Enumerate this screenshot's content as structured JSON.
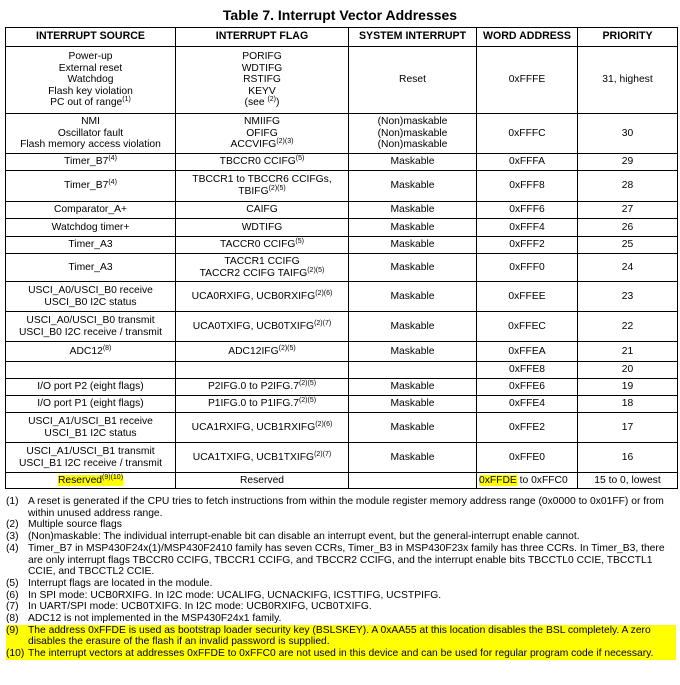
{
  "title": "Table 7. Interrupt Vector Addresses",
  "headers": [
    "INTERRUPT SOURCE",
    "INTERRUPT FLAG",
    "SYSTEM INTERRUPT",
    "WORD ADDRESS",
    "PRIORITY"
  ],
  "rows": [
    {
      "source": [
        "Power-up",
        "External reset",
        "Watchdog",
        "Flash key violation",
        "PC out of range"
      ],
      "source_sup": [
        "",
        "",
        "",
        "",
        "(1)"
      ],
      "flag": [
        "PORIFG",
        "WDTIFG",
        "RSTIFG",
        "KEYV",
        "(see "
      ],
      "flag_sup": [
        "",
        "",
        "",
        "",
        "(2)"
      ],
      "flag_after": [
        "",
        "",
        "",
        "",
        ")"
      ],
      "system": [
        "Reset"
      ],
      "address": "0xFFFE",
      "priority": "31, highest"
    },
    {
      "source": [
        "NMI",
        "Oscillator fault",
        "Flash memory access violation"
      ],
      "source_sup": [
        "",
        "",
        ""
      ],
      "flag": [
        "NMIIFG",
        "OFIFG",
        "ACCVIFG"
      ],
      "flag_sup": [
        "",
        "",
        "(2)(3)"
      ],
      "flag_after": [
        "",
        "",
        ""
      ],
      "system": [
        "(Non)maskable",
        "(Non)maskable",
        "(Non)maskable"
      ],
      "address": "0xFFFC",
      "priority": "30"
    },
    {
      "source": [
        "Timer_B7"
      ],
      "source_sup": [
        "(4)"
      ],
      "flag": [
        "TBCCR0 CCIFG"
      ],
      "flag_sup": [
        "(5)"
      ],
      "flag_after": [
        ""
      ],
      "system": [
        "Maskable"
      ],
      "address": "0xFFFA",
      "priority": "29"
    },
    {
      "source": [
        "Timer_B7"
      ],
      "source_sup": [
        "(4)"
      ],
      "flag": [
        "TBCCR1 to TBCCR6 CCIFGs,",
        "TBIFG"
      ],
      "flag_sup": [
        "",
        "(2)(5)"
      ],
      "flag_after": [
        "",
        ""
      ],
      "system": [
        "Maskable"
      ],
      "address": "0xFFF8",
      "priority": "28"
    },
    {
      "source": [
        "Comparator_A+"
      ],
      "source_sup": [
        ""
      ],
      "flag": [
        "CAIFG"
      ],
      "flag_sup": [
        ""
      ],
      "flag_after": [
        ""
      ],
      "system": [
        "Maskable"
      ],
      "address": "0xFFF6",
      "priority": "27"
    },
    {
      "source": [
        "Watchdog timer+"
      ],
      "source_sup": [
        ""
      ],
      "flag": [
        "WDTIFG"
      ],
      "flag_sup": [
        ""
      ],
      "flag_after": [
        ""
      ],
      "system": [
        "Maskable"
      ],
      "address": "0xFFF4",
      "priority": "26"
    },
    {
      "source": [
        "Timer_A3"
      ],
      "source_sup": [
        ""
      ],
      "flag": [
        "TACCR0 CCIFG"
      ],
      "flag_sup": [
        "(5)"
      ],
      "flag_after": [
        ""
      ],
      "system": [
        "Maskable"
      ],
      "address": "0xFFF2",
      "priority": "25"
    },
    {
      "source": [
        "Timer_A3"
      ],
      "source_sup": [
        ""
      ],
      "flag": [
        "TACCR1 CCIFG",
        "TACCR2 CCIFG TAIFG"
      ],
      "flag_sup": [
        "",
        "(2)(5)"
      ],
      "flag_after": [
        "",
        ""
      ],
      "system": [
        "Maskable"
      ],
      "address": "0xFFF0",
      "priority": "24"
    },
    {
      "source": [
        "USCI_A0/USCI_B0 receive",
        "USCI_B0 I2C status"
      ],
      "source_sup": [
        "",
        ""
      ],
      "flag": [
        "UCA0RXIFG, UCB0RXIFG"
      ],
      "flag_sup": [
        "(2)(6)"
      ],
      "flag_after": [
        ""
      ],
      "system": [
        "Maskable"
      ],
      "address": "0xFFEE",
      "priority": "23"
    },
    {
      "source": [
        "USCI_A0/USCI_B0 transmit",
        "USCI_B0 I2C receive / transmit"
      ],
      "source_sup": [
        "",
        ""
      ],
      "flag": [
        "UCA0TXIFG, UCB0TXIFG"
      ],
      "flag_sup": [
        "(2)(7)"
      ],
      "flag_after": [
        ""
      ],
      "system": [
        "Maskable"
      ],
      "address": "0xFFEC",
      "priority": "22"
    },
    {
      "source": [
        "ADC12"
      ],
      "source_sup": [
        "(8)"
      ],
      "flag": [
        "ADC12IFG"
      ],
      "flag_sup": [
        "(2)(5)"
      ],
      "flag_after": [
        ""
      ],
      "system": [
        "Maskable"
      ],
      "address": "0xFFEA",
      "priority": "21"
    },
    {
      "source": [
        ""
      ],
      "source_sup": [
        ""
      ],
      "flag": [
        ""
      ],
      "flag_sup": [
        ""
      ],
      "flag_after": [
        ""
      ],
      "system": [
        ""
      ],
      "address": "0xFFE8",
      "priority": "20"
    },
    {
      "source": [
        "I/O port P2 (eight flags)"
      ],
      "source_sup": [
        ""
      ],
      "flag": [
        "P2IFG.0 to P2IFG.7"
      ],
      "flag_sup": [
        "(2)(5)"
      ],
      "flag_after": [
        ""
      ],
      "system": [
        "Maskable"
      ],
      "address": "0xFFE6",
      "priority": "19"
    },
    {
      "source": [
        "I/O port P1 (eight flags)"
      ],
      "source_sup": [
        ""
      ],
      "flag": [
        "P1IFG.0 to P1IFG.7"
      ],
      "flag_sup": [
        "(2)(5)"
      ],
      "flag_after": [
        ""
      ],
      "system": [
        "Maskable"
      ],
      "address": "0xFFE4",
      "priority": "18"
    },
    {
      "source": [
        "USCI_A1/USCI_B1 receive",
        "USCI_B1 I2C status"
      ],
      "source_sup": [
        "",
        ""
      ],
      "flag": [
        "UCA1RXIFG, UCB1RXIFG"
      ],
      "flag_sup": [
        "(2)(6)"
      ],
      "flag_after": [
        ""
      ],
      "system": [
        "Maskable"
      ],
      "address": "0xFFE2",
      "priority": "17"
    },
    {
      "source": [
        "USCI_A1/USCI_B1 transmit",
        "USCI_B1 I2C receive / transmit"
      ],
      "source_sup": [
        "",
        ""
      ],
      "flag": [
        "UCA1TXIFG, UCB1TXIFG"
      ],
      "flag_sup": [
        "(2)(7)"
      ],
      "flag_after": [
        ""
      ],
      "system": [
        "Maskable"
      ],
      "address": "0xFFE0",
      "priority": "16"
    }
  ],
  "reserved_row": {
    "source": "Reserved",
    "source_sup": "(9)(10)",
    "flag": "Reserved",
    "system": "",
    "address_start": "0xFFDE",
    "address_rest": " to 0xFFC0",
    "priority": "15 to 0, lowest"
  },
  "highlight_color": "#ffff00",
  "footnotes": [
    {
      "num": "(1)",
      "text": "A reset is generated if the CPU tries to fetch instructions from within the module register memory address range (0x0000 to 0x01FF) or from within unused address range.",
      "highlighted": false
    },
    {
      "num": "(2)",
      "text": "Multiple source flags",
      "highlighted": false
    },
    {
      "num": "(3)",
      "text": "(Non)maskable: The individual interrupt-enable bit can disable an interrupt event, but the general-interrupt enable cannot.",
      "highlighted": false
    },
    {
      "num": "(4)",
      "text": "Timer_B7 in MSP430F24x(1)/MSP430F2410 family has seven CCRs, Timer_B3 in MSP430F23x family has three CCRs. In Timer_B3, there are only interrupt flags TBCCR0 CCIFG, TBCCR1 CCIFG, and TBCCR2 CCIFG, and the interrupt enable bits TBCCTL0 CCIE, TBCCTL1 CCIE, and TBCCTL2 CCIE.",
      "highlighted": false
    },
    {
      "num": "(5)",
      "text": "Interrupt flags are located in the module.",
      "highlighted": false
    },
    {
      "num": "(6)",
      "text": "In SPI mode: UCB0RXIFG. In I2C mode: UCALIFG, UCNACKIFG, ICSTTIFG, UCSTPIFG.",
      "highlighted": false
    },
    {
      "num": "(7)",
      "text": "In UART/SPI mode: UCB0TXIFG. In I2C mode: UCB0RXIFG, UCB0TXIFG.",
      "highlighted": false
    },
    {
      "num": "(8)",
      "text": "ADC12 is not implemented in the MSP430F24x1 family.",
      "highlighted": false
    },
    {
      "num": "(9)",
      "text": "The address 0xFFDE is used as bootstrap loader security key (BSLSKEY). A 0xAA55 at this location disables the BSL completely. A zero disables the erasure of the flash if an invalid password is supplied.",
      "highlighted": true
    },
    {
      "num": "(10)",
      "text": "The interrupt vectors at addresses 0xFFDE to 0xFFC0 are not used in this device and can be used for regular program code if necessary.",
      "highlighted": true
    }
  ]
}
